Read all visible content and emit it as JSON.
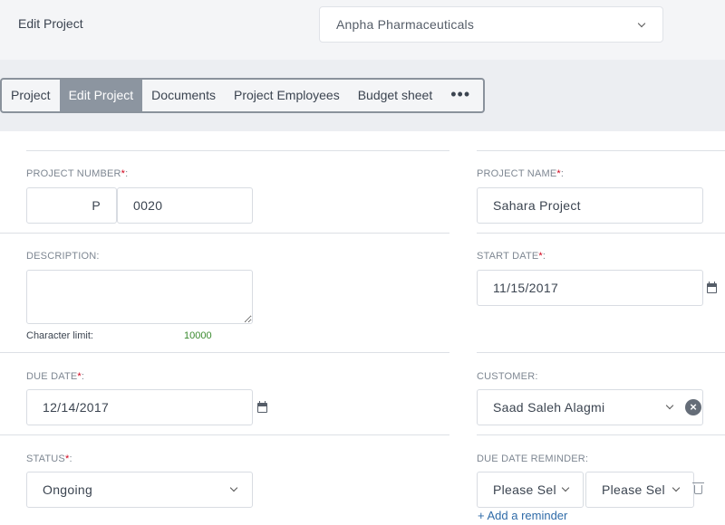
{
  "header": {
    "title": "Edit Project",
    "company": "Anpha Pharmaceuticals"
  },
  "tabs": [
    "Project",
    "Edit Project",
    "Documents",
    "Project Employees",
    "Budget sheet",
    "•••"
  ],
  "form": {
    "project_number": {
      "label": "PROJECT NUMBER",
      "prefix": "P",
      "value": "0020"
    },
    "project_name": {
      "label": "PROJECT NAME",
      "value": "Sahara Project"
    },
    "description": {
      "label": "DESCRIPTION:",
      "value": "",
      "char_limit_label": "Character limit:",
      "char_limit_value": "10000"
    },
    "start_date": {
      "label": "START DATE",
      "value": "11/15/2017"
    },
    "due_date": {
      "label": "DUE DATE",
      "value": "12/14/2017"
    },
    "customer": {
      "label": "CUSTOMER:",
      "value": "Saad Saleh Alagmi"
    },
    "status": {
      "label": "STATUS",
      "value": "Ongoing"
    },
    "due_date_reminder": {
      "label": "DUE DATE REMINDER:",
      "select1": "Please Sel",
      "select2": "Please Sel",
      "add_label": "+ Add a reminder"
    }
  }
}
